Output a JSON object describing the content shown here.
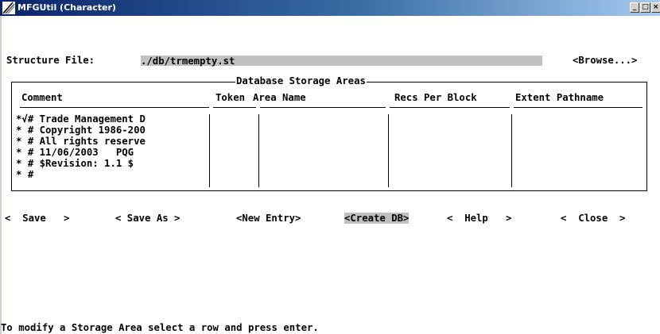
{
  "window": {
    "title": "MFGUtil (Character)",
    "controls": {
      "minimize": "_",
      "maximize": "□",
      "close": "×"
    }
  },
  "structure": {
    "label": "Structure File:",
    "value": "./db/trmempty.st",
    "browse_label": "<Browse...>"
  },
  "storage_areas": {
    "frame_title": "Database Storage Areas",
    "columns": [
      "Comment",
      "Token",
      "Area Name",
      "Recs Per Block",
      "Extent Pathname"
    ],
    "rows": [
      {
        "marker": "*√",
        "comment": "# Trade Management D",
        "token": "",
        "area_name": "",
        "recs_per_block": "",
        "extent_pathname": ""
      },
      {
        "marker": "* ",
        "comment": "# Copyright 1986-200",
        "token": "",
        "area_name": "",
        "recs_per_block": "",
        "extent_pathname": ""
      },
      {
        "marker": "* ",
        "comment": "# All rights reserve",
        "token": "",
        "area_name": "",
        "recs_per_block": "",
        "extent_pathname": ""
      },
      {
        "marker": "* ",
        "comment": "# 11/06/2003   PQG",
        "token": "",
        "area_name": "",
        "recs_per_block": "",
        "extent_pathname": ""
      },
      {
        "marker": "* ",
        "comment": "# $Revision: 1.1 $",
        "token": "",
        "area_name": "",
        "recs_per_block": "",
        "extent_pathname": ""
      },
      {
        "marker": "* ",
        "comment": "#",
        "token": "",
        "area_name": "",
        "recs_per_block": "",
        "extent_pathname": ""
      }
    ]
  },
  "buttons": {
    "save": "<  Save   >",
    "save_as": "< Save As >",
    "new_entry": "<New Entry>",
    "create_db": "<Create DB>",
    "help": "<  Help   >",
    "close": "<  Close  >"
  },
  "status": {
    "message": "To modify a Storage Area select a row and press enter."
  }
}
